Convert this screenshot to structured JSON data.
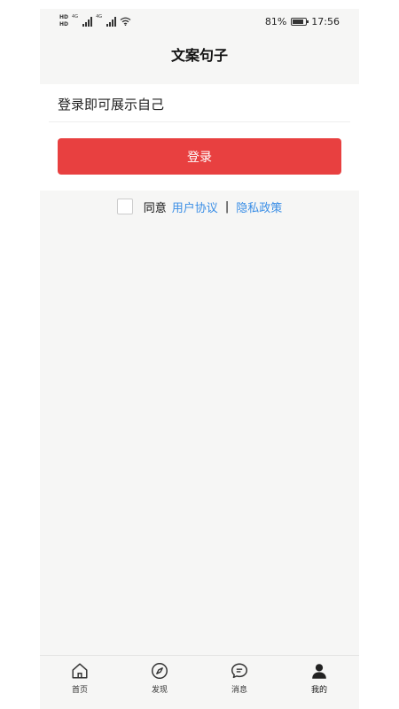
{
  "status_bar": {
    "hd_top": "HD",
    "hd_bottom": "HD",
    "net1": "4G",
    "net2": "4G",
    "battery_percent": "81%",
    "battery_level": 0.81,
    "time": "17:56"
  },
  "header": {
    "title": "文案句子"
  },
  "main": {
    "prompt": "登录即可展示自己",
    "login_button": "登录",
    "agreement": {
      "agree_label": "同意",
      "user_agreement": "用户协议",
      "separator": "|",
      "privacy_policy": "隐私政策"
    }
  },
  "bottom_nav": {
    "items": [
      {
        "label": "首页",
        "icon": "home-icon"
      },
      {
        "label": "发现",
        "icon": "compass-icon"
      },
      {
        "label": "消息",
        "icon": "chat-icon"
      },
      {
        "label": "我的",
        "icon": "person-icon"
      }
    ],
    "active": "我的"
  }
}
